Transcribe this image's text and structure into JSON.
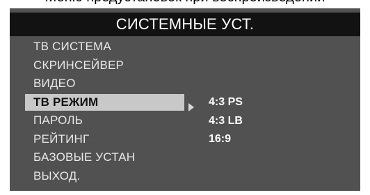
{
  "header": {
    "partial_text": "Меню предустановок при воспроизведении"
  },
  "window": {
    "title": "СИСТЕМНЫЕ УСТ."
  },
  "menu": {
    "items": [
      {
        "label": "ТВ СИСТЕМА"
      },
      {
        "label": "СКРИНСЕЙВЕР"
      },
      {
        "label": "ВИДЕО"
      },
      {
        "label": "ТВ РЕЖИМ",
        "selected": true
      },
      {
        "label": "ПАРОЛЬ"
      },
      {
        "label": "РЕЙТИНГ"
      },
      {
        "label": "БАЗОВЫЕ УСТАН"
      },
      {
        "label": "ВЫХОД."
      }
    ]
  },
  "submenu": {
    "options": [
      {
        "label": "4:3 PS"
      },
      {
        "label": "4:3 LB"
      },
      {
        "label": "16:9"
      }
    ]
  },
  "icons": {
    "selection_arrow": "play-arrow-icon"
  },
  "colors": {
    "panel": "#515151",
    "title_bar": "#121212",
    "highlight": "#c8c8c8",
    "text": "#ffffff"
  }
}
